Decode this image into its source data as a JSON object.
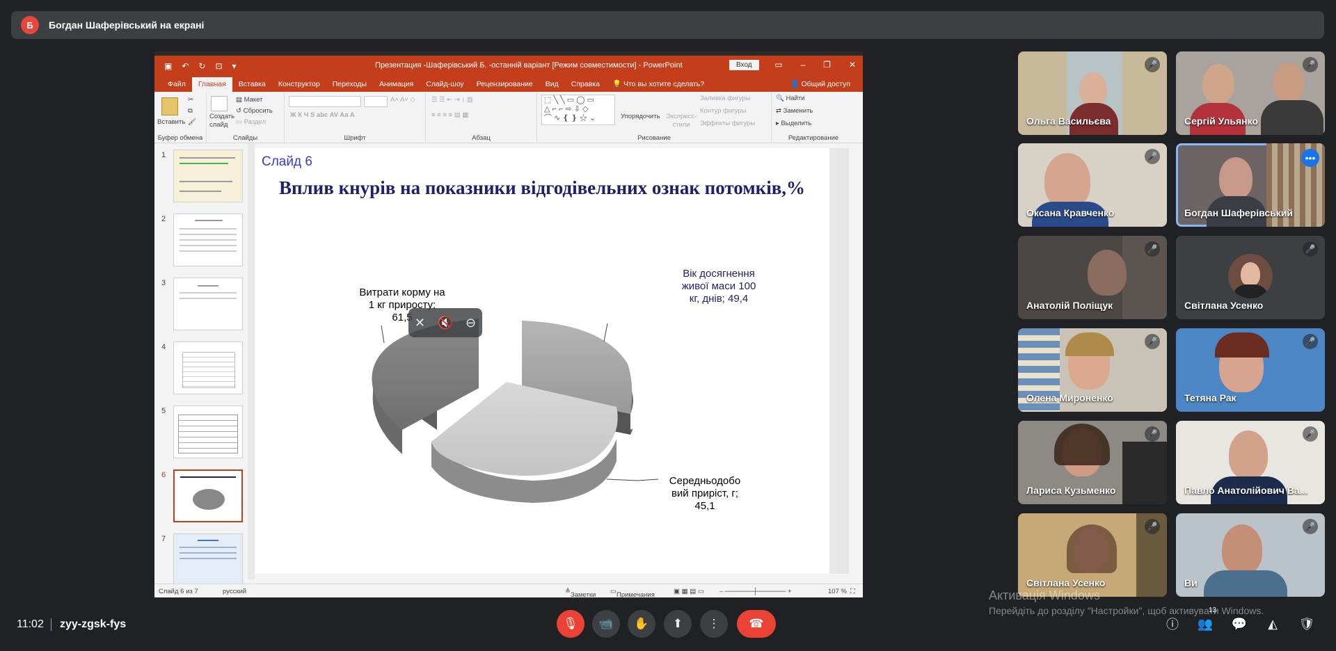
{
  "presenter_bar": {
    "avatar_letter": "Б",
    "text": "Богдан Шаферівський на екрані"
  },
  "powerpoint": {
    "title": "Презентация -Шаферівський Б. -останній варіант [Режим совместимости]  -  PowerPoint",
    "login_label": "Вход",
    "tabs": [
      "Файл",
      "Главная",
      "Вставка",
      "Конструктор",
      "Переходы",
      "Анимация",
      "Слайд-шоу",
      "Рецензирование",
      "Вид",
      "Справка",
      "Что вы хотите сделать?"
    ],
    "share_label": "Общий доступ",
    "ribbon": {
      "paste": "Вставить",
      "clipboard": "Буфер обмена",
      "create_slide": "Создать слайд",
      "layout": "Макет",
      "reset": "Сбросить",
      "section": "Раздел",
      "slides": "Слайды",
      "font": "Шрифт",
      "paragraph": "Абзац",
      "arrange": "Упорядочить",
      "express_styles": "Экспресс-стили",
      "fill": "Заливка фигуры",
      "outline": "Контур фигуры",
      "effects": "Эффекты фигуры",
      "drawing": "Рисование",
      "find": "Найти",
      "replace": "Заменить",
      "select": "Выделить",
      "editing": "Редактирование"
    },
    "thumb_numbers": [
      "1",
      "2",
      "3",
      "4",
      "5",
      "6",
      "7"
    ],
    "slide": {
      "number_label": "Слайд 6",
      "title": "Вплив кнурів на показники відгодівельних ознак потомків,%",
      "labels": {
        "feed": "Витрати корму на 1 кг приросту; 61,5",
        "age": "Вік досягнення живої маси 100 кг, днів; 49,4",
        "gain": "Середньодобо вий приріст, г; 45,1"
      }
    },
    "statusbar": {
      "slide_of": "Слайд 6 из 7",
      "language": "русский",
      "notes": "Заметки",
      "comments": "Примечания",
      "zoom": "107 %"
    }
  },
  "chart_data": {
    "type": "pie",
    "categories": [
      "Витрати корму на 1 кг приросту",
      "Вік досягнення живої маси 100 кг, днів",
      "Середньодобо вий приріст, г"
    ],
    "values": [
      61.5,
      49.4,
      45.1
    ],
    "title": "Вплив кнурів на показники відгодівельних ознак потомків,%"
  },
  "participants": [
    {
      "name": "Ольга Васильєва"
    },
    {
      "name": "Сергій Ульянко"
    },
    {
      "name": "Оксана Кравченко"
    },
    {
      "name": "Богдан Шаферівський"
    },
    {
      "name": "Анатолій Поліщук"
    },
    {
      "name": "Світлана Усенко"
    },
    {
      "name": "Олена Мироненко"
    },
    {
      "name": "Тетяна Рак"
    },
    {
      "name": "Лариса Кузьменко"
    },
    {
      "name": "Павло Анатолійович Ва..."
    },
    {
      "name": "Світлана Усенко"
    },
    {
      "name": "Ви"
    }
  ],
  "watermark": {
    "line1": "Активація Windows",
    "line2": "Перейдіть до розділу \"Настройки\", щоб активувати Windows."
  },
  "bottom": {
    "time": "11:02",
    "meeting_code": "zyy-zgsk-fys",
    "people_count": "13"
  },
  "colors": {
    "accent_red": "#ea4335",
    "ppt_orange": "#c43e1c",
    "active_blue": "#8ab4f8"
  }
}
